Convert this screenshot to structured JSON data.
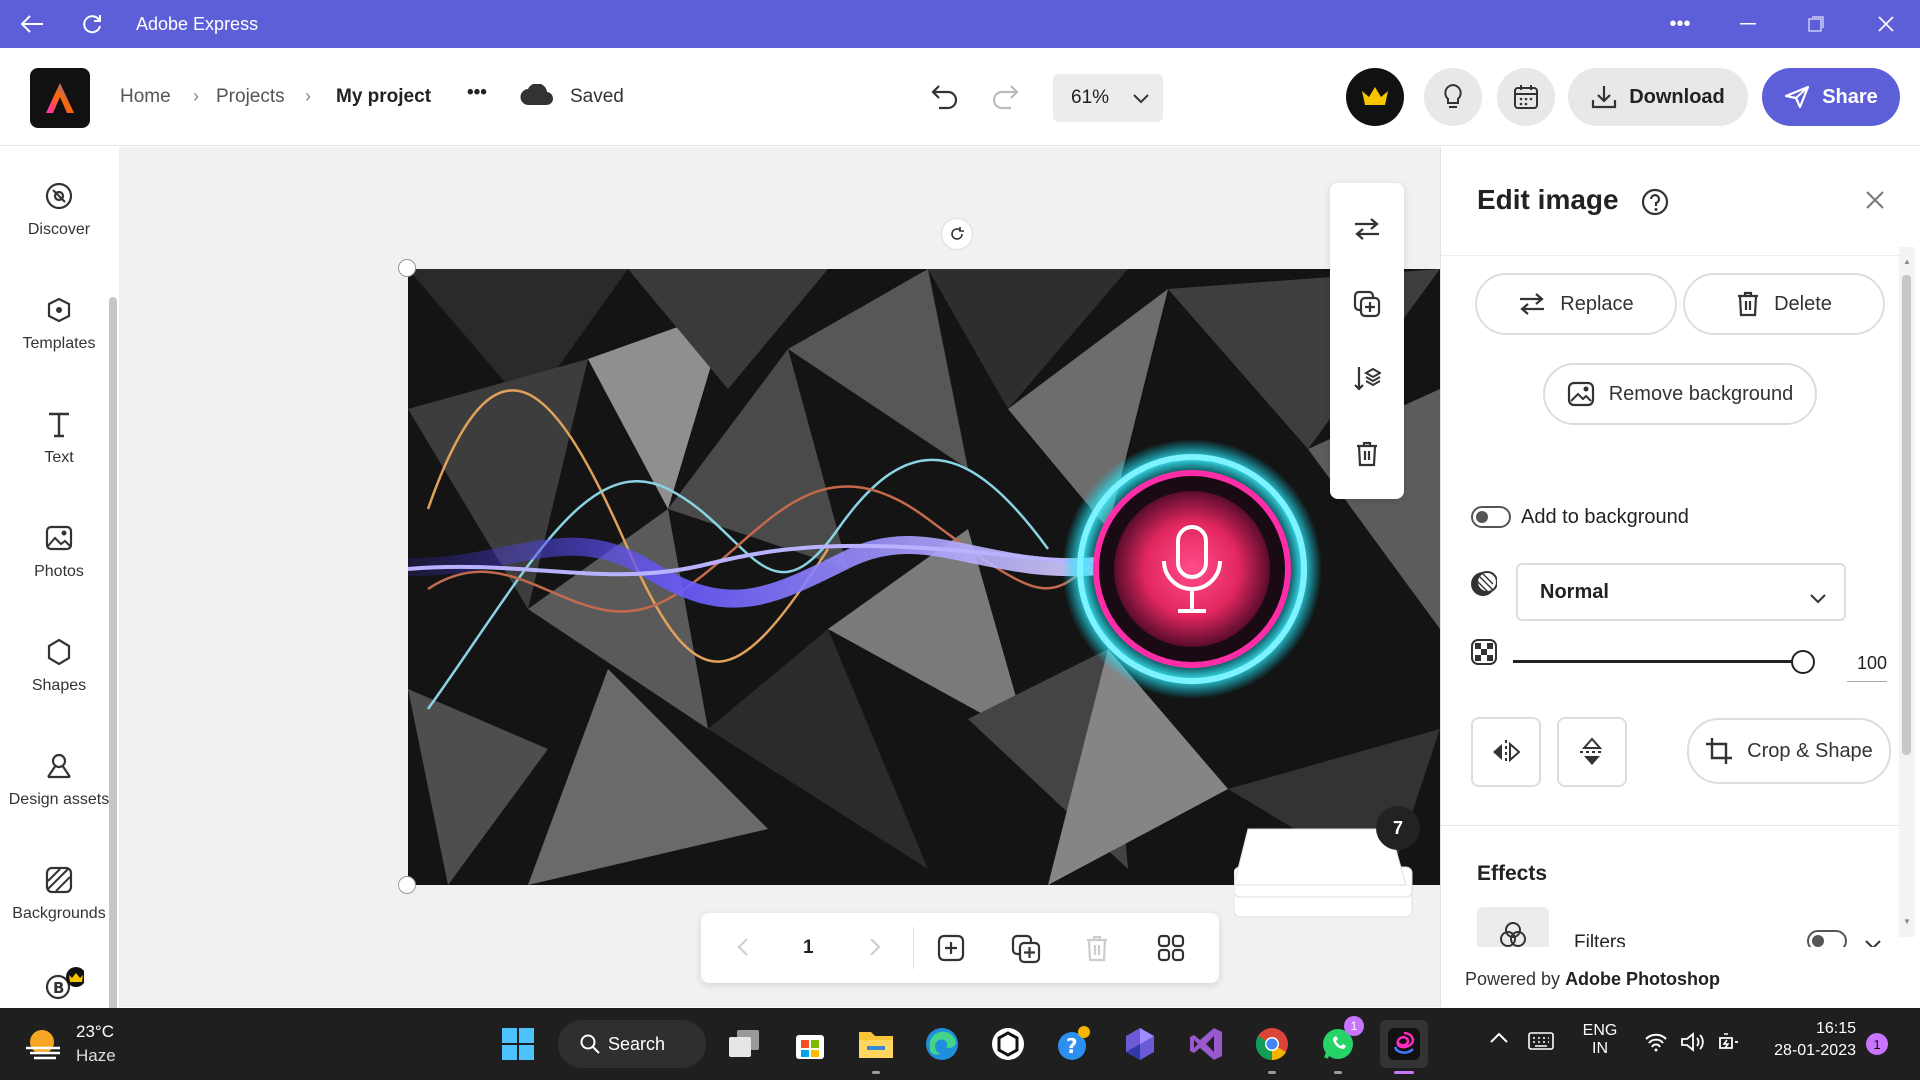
{
  "titlebar": {
    "title": "Adobe Express"
  },
  "header": {
    "breadcrumb": [
      "Home",
      "Projects",
      "My project"
    ],
    "more": "•••",
    "save_status": "Saved",
    "zoom": "61%",
    "download_label": "Download",
    "share_label": "Share"
  },
  "leftrail": {
    "items": [
      {
        "label": "Discover"
      },
      {
        "label": "Templates"
      },
      {
        "label": "Text"
      },
      {
        "label": "Photos"
      },
      {
        "label": "Shapes"
      },
      {
        "label": "Design assets"
      },
      {
        "label": "Backgrounds"
      }
    ]
  },
  "pagebar": {
    "page": "1"
  },
  "pages_badge": "7",
  "panel": {
    "title": "Edit image",
    "replace": "Replace",
    "delete": "Delete",
    "remove_bg": "Remove background",
    "add_to_bg": "Add to background",
    "blend_mode": "Normal",
    "opacity": "100",
    "opacity_fraction": 1.0,
    "crop": "Crop & Shape",
    "effects": "Effects",
    "filters": "Filters",
    "powered_prefix": "Powered by ",
    "powered_brand": "Adobe Photoshop"
  },
  "taskbar": {
    "weather_temp": "23°C",
    "weather_desc": "Haze",
    "search": "Search",
    "lang1": "ENG",
    "lang2": "IN",
    "time": "16:15",
    "date": "28-01-2023",
    "notif": "1",
    "whatsapp_badge": "1"
  },
  "colors": {
    "titlebar": "#5d5fd8",
    "share": "#5d5fd8",
    "taskbar": "#1f1f1f"
  }
}
